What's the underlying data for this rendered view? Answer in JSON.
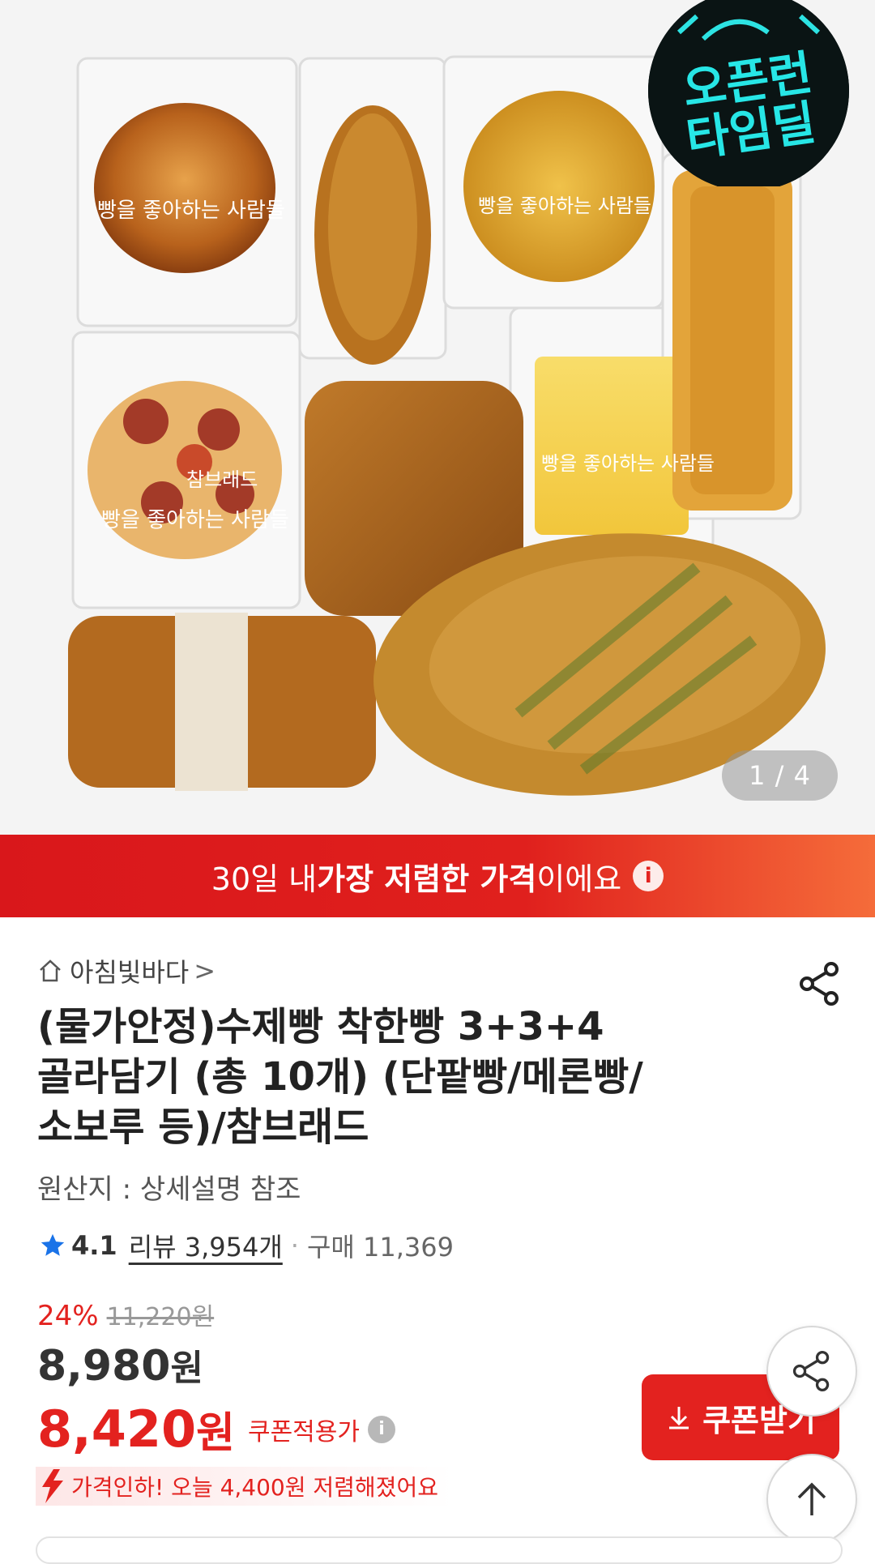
{
  "hero": {
    "badge_line1": "오픈런",
    "badge_line2": "타임딜",
    "counter": "1 / 4",
    "package_text": "빵을 좋아하는 사람들",
    "brand_text": "참브래드"
  },
  "banner": {
    "prefix": "30일 내 ",
    "highlight": "가장 저렴한 가격",
    "suffix": "이에요",
    "info_glyph": "i"
  },
  "seller": {
    "name": "아침빛바다",
    "chevron": ">"
  },
  "product": {
    "title_line1": "(물가안정)수제빵 착한빵 3+3+4",
    "title_line2": "골라담기 (총 10개) (단팥빵/메론빵/",
    "title_line3": "소보루 등)/참브래드",
    "origin": "원산지 : 상세설명 참조"
  },
  "rating": {
    "score": "4.1",
    "reviews": "리뷰 3,954개",
    "separator": "·",
    "purchases": "구매 11,369"
  },
  "price": {
    "discount_pct": "24%",
    "original": "11,220원",
    "sale_value": "8,980",
    "sale_unit": "원",
    "coupon_value": "8,420",
    "coupon_unit": "원",
    "coupon_label": "쿠폰적용가",
    "info_glyph": "i",
    "drop_text": "가격인하! 오늘 4,400원 저렴해졌어요"
  },
  "buttons": {
    "coupon": "쿠폰받기"
  },
  "colors": {
    "accent": "#e3221f",
    "banner_end": "#f56c3a",
    "star": "#1a73e8"
  }
}
